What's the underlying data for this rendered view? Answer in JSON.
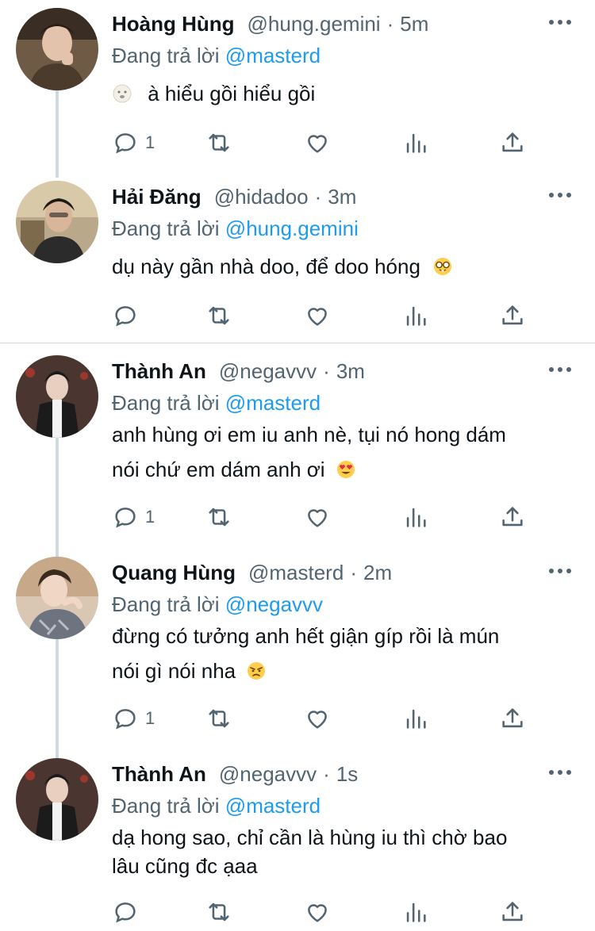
{
  "tweets": [
    {
      "name": "Hoàng Hùng",
      "handle": "@hung.gemini",
      "time": "5m",
      "reply_prefix": "Đang trả lời",
      "reply_to": "@masterd",
      "lines": [
        "à hiểu gồi hiểu gồi"
      ],
      "leading_emoji": "face-exhaling",
      "trailing_emoji": "",
      "reply_count": "1"
    },
    {
      "name": "Hải Đăng",
      "handle": "@hidadoo",
      "time": "3m",
      "reply_prefix": "Đang trả lời",
      "reply_to": "@hung.gemini",
      "lines": [
        "dụ này gần nhà doo, để doo hóng"
      ],
      "leading_emoji": "",
      "trailing_emoji": "nerd-face",
      "reply_count": ""
    },
    {
      "name": "Thành An",
      "handle": "@negavvv",
      "time": "3m",
      "reply_prefix": "Đang trả lời",
      "reply_to": "@masterd",
      "lines": [
        "anh hùng ơi em iu anh nè, tụi nó hong dám",
        "nói chứ em dám anh ơi"
      ],
      "leading_emoji": "",
      "trailing_emoji": "heart-eyes",
      "reply_count": "1"
    },
    {
      "name": "Quang Hùng",
      "handle": "@masterd",
      "time": "2m",
      "reply_prefix": "Đang trả lời",
      "reply_to": "@negavvv",
      "lines": [
        "đừng có tưởng anh hết giận gíp rồi là mún",
        "nói gì nói nha"
      ],
      "leading_emoji": "",
      "trailing_emoji": "angry-face",
      "reply_count": "1"
    },
    {
      "name": "Thành An",
      "handle": "@negavvv",
      "time": "1s",
      "reply_prefix": "Đang trả lời",
      "reply_to": "@masterd",
      "lines": [
        "dạ hong sao, chỉ cần là hùng iu thì chờ bao",
        "lâu cũng đc ạaa"
      ],
      "leading_emoji": "",
      "trailing_emoji": "",
      "reply_count": ""
    }
  ],
  "icons": {
    "reply": "reply-icon",
    "retweet": "retweet-icon",
    "like": "like-icon",
    "views": "views-icon",
    "share": "share-icon",
    "more": "more-icon"
  },
  "colors": {
    "text": "#0f1419",
    "secondary": "#536471",
    "mention": "#1d9bf0",
    "divider": "#cfd9de"
  }
}
